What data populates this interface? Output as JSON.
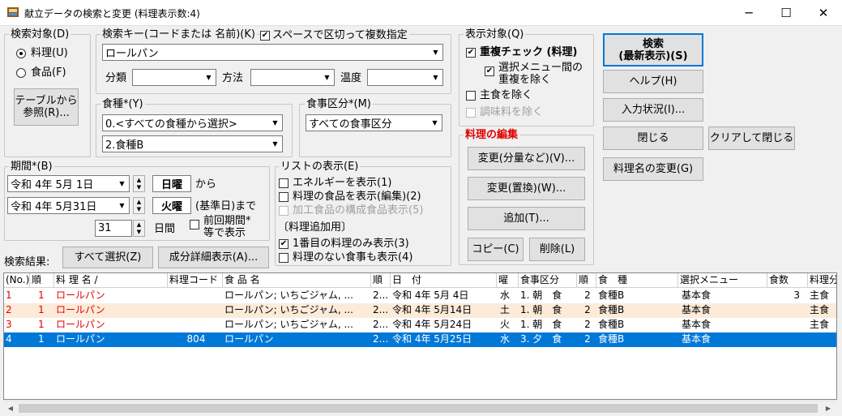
{
  "window": {
    "title": "献立データの検索と変更 (料理表示数:4)",
    "min": "─",
    "max": "☐",
    "close": "✕"
  },
  "search_target": {
    "title": "検索対象(D)",
    "opt1": "料理(U)",
    "opt2": "食品(F)",
    "ref_btn_line1": "テーブルから",
    "ref_btn_line2": "参照(R)..."
  },
  "search_key": {
    "title": "検索キー(コードまたは 名前)(K)",
    "space_opt": "スペースで区切って複数指定",
    "value": "ロールパン",
    "bunrui": "分類",
    "houhou": "方法",
    "ondo": "温度"
  },
  "food_type": {
    "title": "食種*(Y)",
    "sel1": "0.<すべての食種から選択>",
    "sel2": "2.食種B"
  },
  "meal_div": {
    "title": "食事区分*(M)",
    "sel": "すべての食事区分"
  },
  "display_target": {
    "title": "表示対象(Q)",
    "dup_check": "重複チェック (料理)",
    "sel_menu_line1": "選択メニュー間の",
    "sel_menu_line2": "重複を除く",
    "exclude_staple": "主食を除く",
    "exclude_season": "調味料を除く"
  },
  "buttons": {
    "search_line1": "検索",
    "search_line2": "(最新表示)(S)",
    "help": "ヘルプ(H)",
    "input_status": "入力状況(I)...",
    "close": "閉じる",
    "clear_close": "クリアして閉じる",
    "rename": "料理名の変更(G)",
    "select_all": "すべて選択(Z)",
    "detail": "成分詳細表示(A)..."
  },
  "dish_edit": {
    "title": "料理の編集",
    "change_amount": "変更(分量など)(V)...",
    "change_replace": "変更(置換)(W)...",
    "add": "追加(T)...",
    "copy": "コピー(C)",
    "delete": "削除(L)"
  },
  "period": {
    "title": "期間*(B)",
    "from_date": "令和 4年 5月 1日",
    "from_day": "日曜",
    "from_suffix": "から",
    "to_date": "令和 4年 5月31日",
    "to_day": "火曜",
    "to_suffix": "(基準日)まで",
    "days": "31",
    "days_unit": "日間",
    "prev_line1": "前回期間*",
    "prev_line2": "等で表示"
  },
  "list_display": {
    "title": "リストの表示(E)",
    "energy": "エネルギーを表示(1)",
    "foods_edit": "料理の食品を表示(編集)(2)",
    "processed": "加工食品の構成食品表示(5)",
    "add_note": "〔料理追加用〕",
    "first_only": "1番目の料理のみ表示(3)",
    "no_dish": "料理のない食事も表示(4)"
  },
  "result_label": "検索結果:",
  "grid": {
    "headers": [
      "(No.)",
      "順",
      "料 理 名 /",
      "料理コード",
      "食 品 名",
      "順",
      "日　付",
      "曜",
      "食事区分",
      "順",
      "食　種",
      "選択メニュー",
      "食数",
      "料理分"
    ],
    "rows": [
      [
        "1",
        "1",
        "ロールパン",
        "",
        "ロールパン; いちごジャム, ...",
        "2...",
        "令和 4年 5月 4日",
        "水",
        "1. 朝　食",
        "2",
        "食種B",
        "基本食",
        "3",
        "主食"
      ],
      [
        "2",
        "1",
        "ロールパン",
        "",
        "ロールパン; いちごジャム, ...",
        "2...",
        "令和 4年 5月14日",
        "土",
        "1. 朝　食",
        "2",
        "食種B",
        "基本食",
        "",
        "主食"
      ],
      [
        "3",
        "1",
        "ロールパン",
        "",
        "ロールパン; いちごジャム, ...",
        "2...",
        "令和 4年 5月24日",
        "火",
        "1. 朝　食",
        "2",
        "食種B",
        "基本食",
        "",
        "主食"
      ],
      [
        "4",
        "1",
        "ロールパン",
        "804",
        "ロールパン",
        "2...",
        "令和 4年 5月25日",
        "水",
        "3. 夕　食",
        "2",
        "食種B",
        "基本食",
        "",
        ""
      ]
    ]
  },
  "colors": {
    "accent": "#0078d7",
    "red_text": "#e00000",
    "row_alt": "#fdebd9",
    "selected": "#0078d7"
  }
}
